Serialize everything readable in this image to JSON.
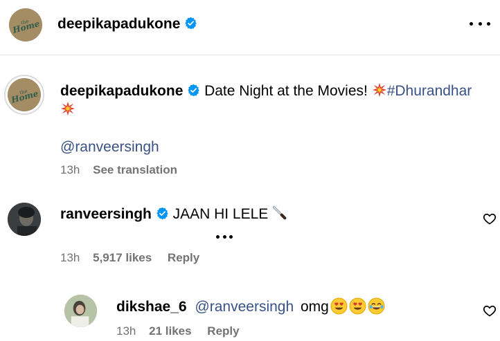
{
  "header": {
    "username": "deepikapadukone",
    "verified": true,
    "menu_icon": "more-horizontal-icon"
  },
  "caption": {
    "username": "deepikapadukone",
    "text": "Date Night at the Movies!",
    "hashtag": "#Dhurandhar",
    "mention": "@ranveersingh",
    "time": "13h",
    "translate_label": "See translation"
  },
  "comments": [
    {
      "username": "ranveersingh",
      "verified": true,
      "text": "JAAN HI LELE",
      "emoji": "knife-emoji",
      "time": "13h",
      "likes": "5,917 likes",
      "reply_label": "Reply"
    },
    {
      "username": "dikshae_6",
      "mention": "@ranveersingh",
      "text": "omg",
      "emojis": [
        "heart-eyes-emoji",
        "heart-eyes-emoji",
        "tears-of-joy-emoji"
      ],
      "time": "13h",
      "likes": "21 likes",
      "reply_label": "Reply"
    }
  ],
  "colors": {
    "link": "#385185",
    "muted": "#737373",
    "verified": "#0095f6",
    "divider": "#e6e6e6"
  }
}
